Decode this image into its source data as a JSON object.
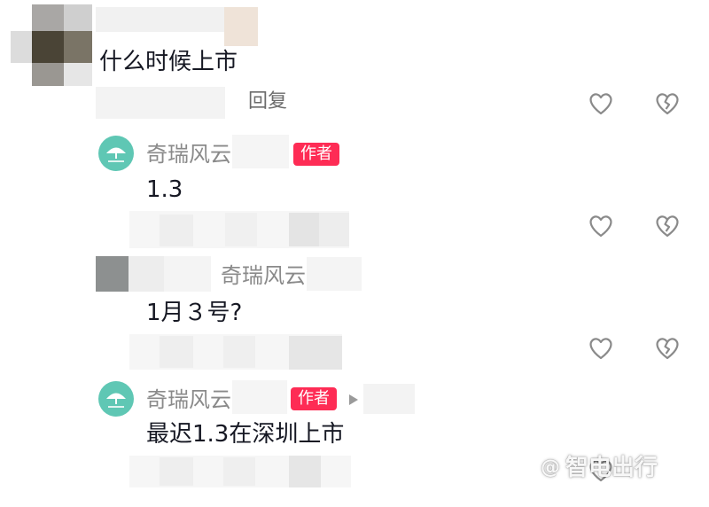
{
  "comment": {
    "text": "什么时候上市",
    "reply_label": "回复"
  },
  "replies": [
    {
      "author": "奇瑞风云",
      "badge": "作者",
      "text": "1.3"
    },
    {
      "author": "奇瑞风云",
      "text": "1月３号?"
    },
    {
      "author": "奇瑞风云",
      "badge": "作者",
      "text": "最迟1.3在深圳上市"
    }
  ],
  "icons": {
    "like": "heart-outline-icon",
    "dislike": "broken-heart-icon",
    "reply_arrow": "play-arrow-icon"
  },
  "watermark": {
    "symbol": "@",
    "text": "智电出行"
  },
  "colors": {
    "badge": "#fe2c55",
    "avatar": "#5fc7b4",
    "name": "#8a8a8a",
    "text": "#161823"
  }
}
